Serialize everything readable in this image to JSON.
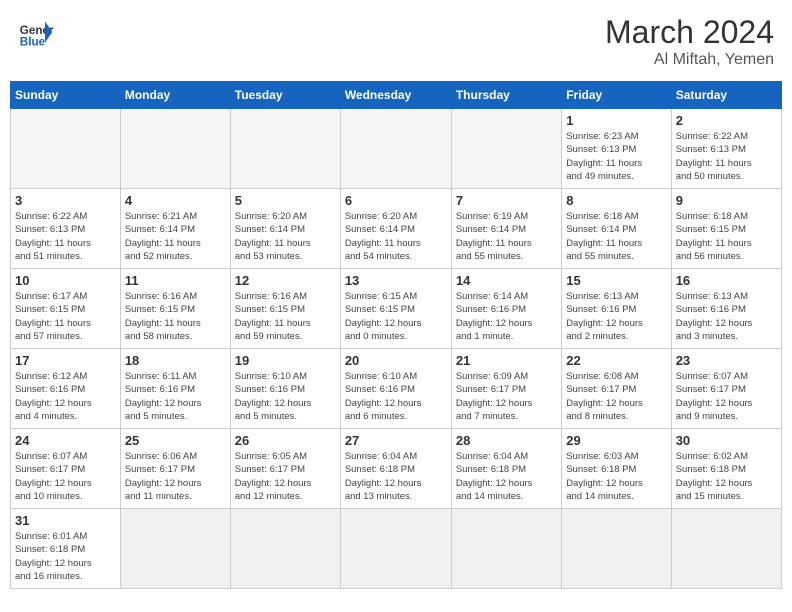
{
  "header": {
    "logo_general": "General",
    "logo_blue": "Blue",
    "month": "March 2024",
    "location": "Al Miftah, Yemen"
  },
  "weekdays": [
    "Sunday",
    "Monday",
    "Tuesday",
    "Wednesday",
    "Thursday",
    "Friday",
    "Saturday"
  ],
  "weeks": [
    [
      {
        "day": "",
        "info": ""
      },
      {
        "day": "",
        "info": ""
      },
      {
        "day": "",
        "info": ""
      },
      {
        "day": "",
        "info": ""
      },
      {
        "day": "",
        "info": ""
      },
      {
        "day": "1",
        "info": "Sunrise: 6:23 AM\nSunset: 6:13 PM\nDaylight: 11 hours\nand 49 minutes."
      },
      {
        "day": "2",
        "info": "Sunrise: 6:22 AM\nSunset: 6:13 PM\nDaylight: 11 hours\nand 50 minutes."
      }
    ],
    [
      {
        "day": "3",
        "info": "Sunrise: 6:22 AM\nSunset: 6:13 PM\nDaylight: 11 hours\nand 51 minutes."
      },
      {
        "day": "4",
        "info": "Sunrise: 6:21 AM\nSunset: 6:14 PM\nDaylight: 11 hours\nand 52 minutes."
      },
      {
        "day": "5",
        "info": "Sunrise: 6:20 AM\nSunset: 6:14 PM\nDaylight: 11 hours\nand 53 minutes."
      },
      {
        "day": "6",
        "info": "Sunrise: 6:20 AM\nSunset: 6:14 PM\nDaylight: 11 hours\nand 54 minutes."
      },
      {
        "day": "7",
        "info": "Sunrise: 6:19 AM\nSunset: 6:14 PM\nDaylight: 11 hours\nand 55 minutes."
      },
      {
        "day": "8",
        "info": "Sunrise: 6:18 AM\nSunset: 6:14 PM\nDaylight: 11 hours\nand 55 minutes."
      },
      {
        "day": "9",
        "info": "Sunrise: 6:18 AM\nSunset: 6:15 PM\nDaylight: 11 hours\nand 56 minutes."
      }
    ],
    [
      {
        "day": "10",
        "info": "Sunrise: 6:17 AM\nSunset: 6:15 PM\nDaylight: 11 hours\nand 57 minutes."
      },
      {
        "day": "11",
        "info": "Sunrise: 6:16 AM\nSunset: 6:15 PM\nDaylight: 11 hours\nand 58 minutes."
      },
      {
        "day": "12",
        "info": "Sunrise: 6:16 AM\nSunset: 6:15 PM\nDaylight: 11 hours\nand 59 minutes."
      },
      {
        "day": "13",
        "info": "Sunrise: 6:15 AM\nSunset: 6:15 PM\nDaylight: 12 hours\nand 0 minutes."
      },
      {
        "day": "14",
        "info": "Sunrise: 6:14 AM\nSunset: 6:16 PM\nDaylight: 12 hours\nand 1 minute."
      },
      {
        "day": "15",
        "info": "Sunrise: 6:13 AM\nSunset: 6:16 PM\nDaylight: 12 hours\nand 2 minutes."
      },
      {
        "day": "16",
        "info": "Sunrise: 6:13 AM\nSunset: 6:16 PM\nDaylight: 12 hours\nand 3 minutes."
      }
    ],
    [
      {
        "day": "17",
        "info": "Sunrise: 6:12 AM\nSunset: 6:16 PM\nDaylight: 12 hours\nand 4 minutes."
      },
      {
        "day": "18",
        "info": "Sunrise: 6:11 AM\nSunset: 6:16 PM\nDaylight: 12 hours\nand 5 minutes."
      },
      {
        "day": "19",
        "info": "Sunrise: 6:10 AM\nSunset: 6:16 PM\nDaylight: 12 hours\nand 5 minutes."
      },
      {
        "day": "20",
        "info": "Sunrise: 6:10 AM\nSunset: 6:16 PM\nDaylight: 12 hours\nand 6 minutes."
      },
      {
        "day": "21",
        "info": "Sunrise: 6:09 AM\nSunset: 6:17 PM\nDaylight: 12 hours\nand 7 minutes."
      },
      {
        "day": "22",
        "info": "Sunrise: 6:08 AM\nSunset: 6:17 PM\nDaylight: 12 hours\nand 8 minutes."
      },
      {
        "day": "23",
        "info": "Sunrise: 6:07 AM\nSunset: 6:17 PM\nDaylight: 12 hours\nand 9 minutes."
      }
    ],
    [
      {
        "day": "24",
        "info": "Sunrise: 6:07 AM\nSunset: 6:17 PM\nDaylight: 12 hours\nand 10 minutes."
      },
      {
        "day": "25",
        "info": "Sunrise: 6:06 AM\nSunset: 6:17 PM\nDaylight: 12 hours\nand 11 minutes."
      },
      {
        "day": "26",
        "info": "Sunrise: 6:05 AM\nSunset: 6:17 PM\nDaylight: 12 hours\nand 12 minutes."
      },
      {
        "day": "27",
        "info": "Sunrise: 6:04 AM\nSunset: 6:18 PM\nDaylight: 12 hours\nand 13 minutes."
      },
      {
        "day": "28",
        "info": "Sunrise: 6:04 AM\nSunset: 6:18 PM\nDaylight: 12 hours\nand 14 minutes."
      },
      {
        "day": "29",
        "info": "Sunrise: 6:03 AM\nSunset: 6:18 PM\nDaylight: 12 hours\nand 14 minutes."
      },
      {
        "day": "30",
        "info": "Sunrise: 6:02 AM\nSunset: 6:18 PM\nDaylight: 12 hours\nand 15 minutes."
      }
    ],
    [
      {
        "day": "31",
        "info": "Sunrise: 6:01 AM\nSunset: 6:18 PM\nDaylight: 12 hours\nand 16 minutes."
      },
      {
        "day": "",
        "info": ""
      },
      {
        "day": "",
        "info": ""
      },
      {
        "day": "",
        "info": ""
      },
      {
        "day": "",
        "info": ""
      },
      {
        "day": "",
        "info": ""
      },
      {
        "day": "",
        "info": ""
      }
    ]
  ]
}
